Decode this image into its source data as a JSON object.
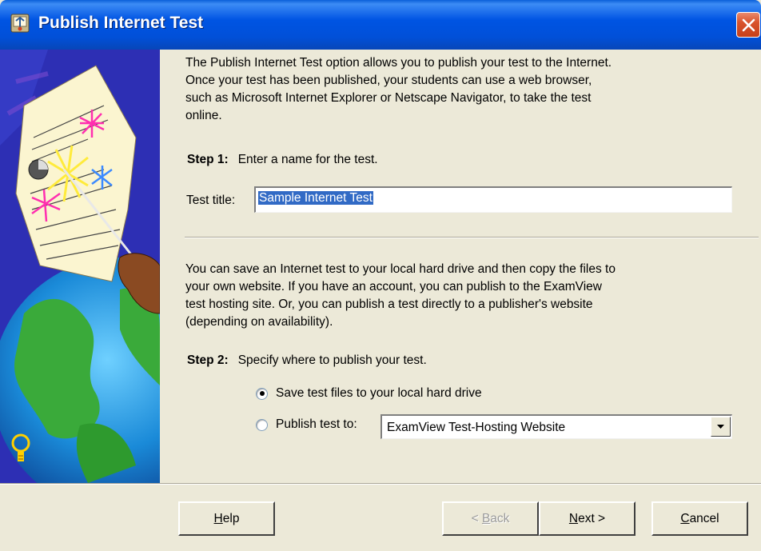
{
  "window": {
    "title": "Publish Internet Test",
    "icon": "publish-wizard-icon"
  },
  "intro_text": "The Publish Internet Test option allows you to publish your test to the Internet.\nOnce your test has been published, your students can use a web browser,\nsuch as Microsoft Internet Explorer or Netscape Navigator, to take the test\nonline.",
  "step1": {
    "label": "Step 1:",
    "instruction": "Enter a name for the test."
  },
  "test_title": {
    "label": "Test title:",
    "value": "Sample Internet Test"
  },
  "description2": "You can save an Internet test to your local hard drive and then copy the files to\nyour own website.  If you have an account, you can publish to the ExamView\ntest hosting site.  Or, you can publish a test directly to a publisher's website\n(depending on availability).",
  "step2": {
    "label": "Step 2:",
    "instruction": "Specify where to publish your test."
  },
  "options": {
    "save_local": {
      "label": "Save test files to your local hard drive",
      "checked": true
    },
    "publish_to": {
      "label": "Publish test to:",
      "checked": false
    }
  },
  "publish_combo": {
    "selected": "ExamView Test-Hosting Website"
  },
  "buttons": {
    "help": {
      "mn": "H",
      "rest": "elp"
    },
    "back": {
      "pre": "< ",
      "mn": "B",
      "rest": "ack",
      "enabled": false
    },
    "next": {
      "mn": "N",
      "rest": "ext >"
    },
    "cancel": {
      "mn": "C",
      "rest": "ancel"
    }
  },
  "colors": {
    "titlebar": "#0054e3",
    "window_face": "#ece9d8",
    "selection": "#316ac5",
    "art_background": "#2d2fb4",
    "close_button": "#d9542c"
  }
}
